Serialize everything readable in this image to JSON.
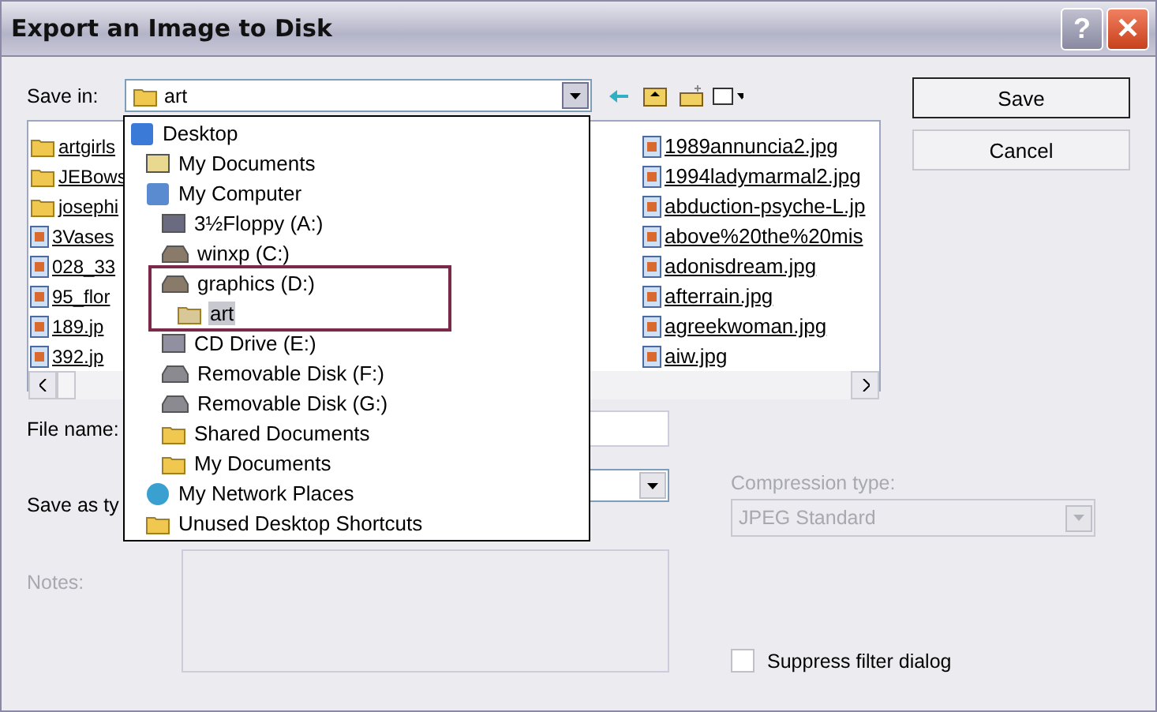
{
  "window": {
    "title": "Export an Image to Disk",
    "buttons": [
      "?",
      "✕"
    ]
  },
  "save_in": {
    "label": "Save in:",
    "value": "art",
    "expanded": true
  },
  "files": {
    "column_1": [
      {
        "name": "artgirls",
        "kind": "folder"
      },
      {
        "name": "JEBows",
        "kind": "folder"
      },
      {
        "name": "josephi",
        "kind": "folder"
      },
      {
        "name": "3Vases",
        "kind": "image"
      },
      {
        "name": "028_33",
        "kind": "image"
      },
      {
        "name": "95_flor",
        "kind": "image"
      },
      {
        "name": "189.jp",
        "kind": "image"
      },
      {
        "name": "392.jp",
        "kind": "image"
      }
    ],
    "column_2": [
      {
        "name": "1989annuncia2.jpg",
        "kind": "image"
      },
      {
        "name": "1994ladymarmal2.jpg",
        "kind": "image"
      },
      {
        "name": "abduction-psyche-L.jp",
        "kind": "image"
      },
      {
        "name": "above%20the%20mis",
        "kind": "image"
      },
      {
        "name": "adonisdream.jpg",
        "kind": "image"
      },
      {
        "name": "afterrain.jpg",
        "kind": "image"
      },
      {
        "name": "agreekwoman.jpg",
        "kind": "image"
      },
      {
        "name": "aiw.jpg",
        "kind": "image"
      }
    ]
  },
  "locations": [
    {
      "label": "Desktop",
      "kind": "desktop",
      "selected": false,
      "children": [
        {
          "label": "My Documents",
          "kind": "documents",
          "selected": false
        },
        {
          "label": "My Computer",
          "kind": "computer",
          "selected": false,
          "children": [
            {
              "label": "3½Floppy (A:)",
              "kind": "floppy",
              "selected": false
            },
            {
              "label": "winxp (C:)",
              "kind": "drive",
              "selected": false
            },
            {
              "label": "graphics (D:)",
              "kind": "drive",
              "selected": false,
              "highlighted": true,
              "children": [
                {
                  "label": "art",
                  "kind": "openfolder",
                  "selected": true
                }
              ]
            },
            {
              "label": "CD Drive (E:)",
              "kind": "cd",
              "selected": false
            },
            {
              "label": "Removable Disk (F:)",
              "kind": "removable",
              "selected": false
            },
            {
              "label": "Removable Disk (G:)",
              "kind": "removable",
              "selected": false
            },
            {
              "label": "Shared Documents",
              "kind": "folder",
              "selected": false
            },
            {
              "label": "My Documents",
              "kind": "folder",
              "selected": false
            }
          ]
        },
        {
          "label": "My Network Places",
          "kind": "network",
          "selected": false
        },
        {
          "label": "Unused Desktop Shortcuts",
          "kind": "folder",
          "selected": false
        }
      ]
    }
  ],
  "file_name": {
    "label": "File name:"
  },
  "save_as_type": {
    "label": "Save as ty"
  },
  "buttons": [
    {
      "label": "Save",
      "default": true
    },
    {
      "label": "Cancel",
      "default": false
    }
  ],
  "compression_type": {
    "label": "Compression type:",
    "value": "JPEG Standard",
    "disabled": true
  },
  "notes": {
    "label": "Notes:",
    "disabled": true
  },
  "suppress_filter_dialog": {
    "label": "Suppress filter dialog",
    "checked": false
  }
}
